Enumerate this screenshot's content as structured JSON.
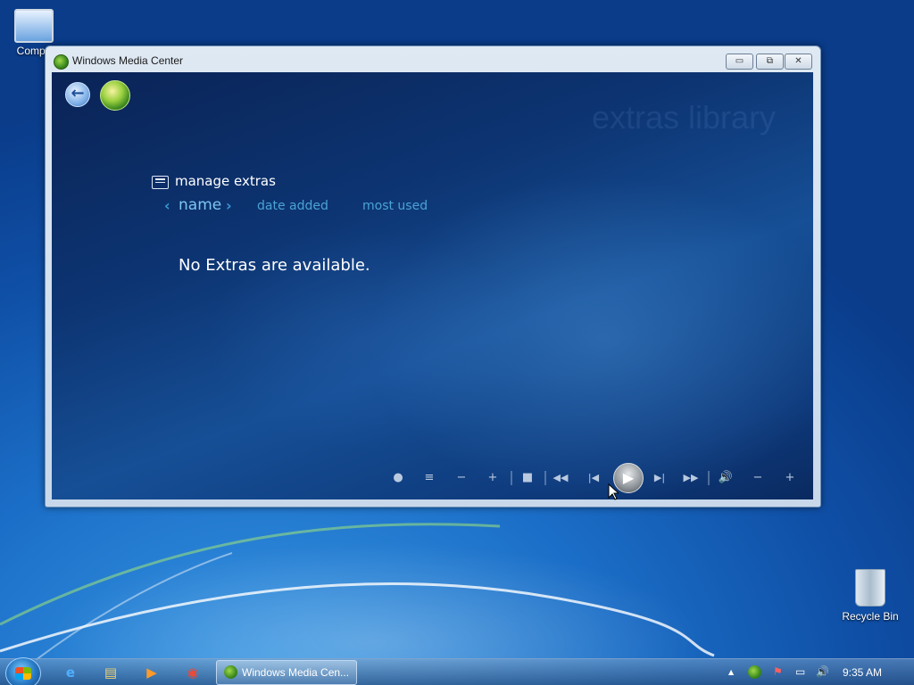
{
  "desktop": {
    "computer_label": "Compu",
    "recycle_label": "Recycle Bin"
  },
  "window": {
    "title": "Windows Media Center",
    "minimize_glyph": "▭",
    "maximize_glyph": "⧉",
    "close_glyph": "✕"
  },
  "wmc": {
    "back_glyph": "←",
    "watermark": "extras library",
    "manage_label": "manage extras",
    "sort": {
      "prev_glyph": "‹",
      "next_glyph": "›",
      "tabs": [
        {
          "label": "name",
          "selected": true
        },
        {
          "label": "date added",
          "selected": false
        },
        {
          "label": "most used",
          "selected": false
        }
      ]
    },
    "empty_message": "No Extras are available.",
    "controls": {
      "record": "●",
      "guide": "≡",
      "ch_down": "−",
      "ch_up": "+",
      "stop": "■",
      "rewind": "◀◀",
      "prev": "|◀",
      "play": "▶",
      "next": "▶|",
      "ff": "▶▶",
      "volume": "🔊",
      "vol_down": "−",
      "vol_up": "+"
    }
  },
  "taskbar": {
    "active_task": "Windows Media Cen...",
    "ie_glyph": "e",
    "explorer_glyph": "▤",
    "media_glyph": "▶",
    "chrome_glyph": "◉",
    "tray_up": "▲",
    "tray_flag": "⚑",
    "tray_network": "▭",
    "tray_volume": "🔊",
    "clock": "9:35 AM"
  }
}
